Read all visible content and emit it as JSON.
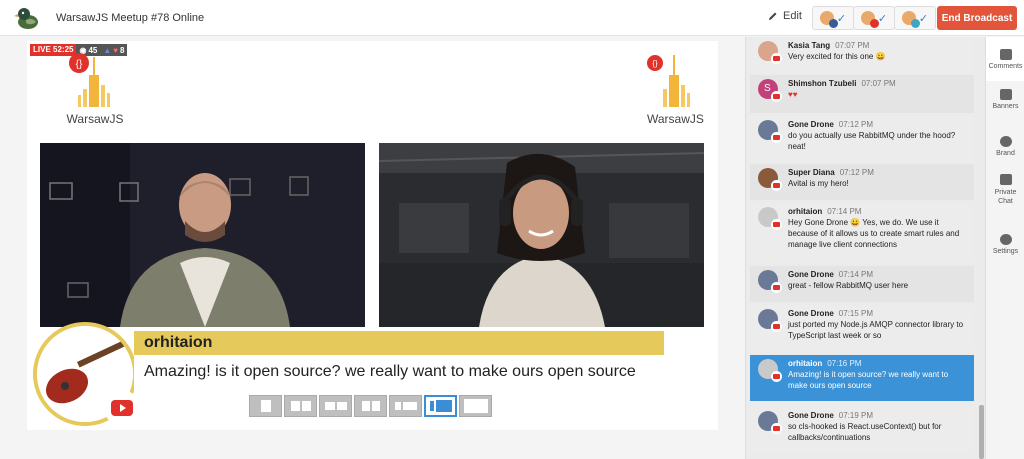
{
  "header": {
    "title": "WarsawJS Meetup #78 Online",
    "edit_label": "Edit",
    "end_label": "End Broadcast",
    "destinations": [
      {
        "network": "facebook",
        "color": "#3b5998"
      },
      {
        "network": "youtube",
        "color": "#e0322a"
      },
      {
        "network": "periscope",
        "color": "#40a4c4"
      }
    ]
  },
  "stage": {
    "live_label": "LIVE 52:25",
    "viewers": "45",
    "reactions": "8",
    "brand_text": "WarsawJS",
    "banner": {
      "name": "orhitaion",
      "message": "Amazing! is it open source? we really want to make ours open source"
    }
  },
  "chat": [
    {
      "name": "Kasia Tang",
      "time": "07:07 PM",
      "text": "Very excited for this one 😀",
      "avatar_color": "#d9a58c"
    },
    {
      "name": "Shimshon Tzubeli",
      "time": "07:07 PM",
      "text": "♥♥",
      "avatar_color": "#c2417a",
      "initial": "S"
    },
    {
      "name": "Gone Drone",
      "time": "07:12 PM",
      "text": "do you actually use RabbitMQ under the hood? neat!",
      "avatar_color": "#6a7a96"
    },
    {
      "name": "Super Diana",
      "time": "07:12 PM",
      "text": "Avital is my hero!",
      "avatar_color": "#8a5a3a"
    },
    {
      "name": "orhitaion",
      "time": "07:14 PM",
      "text": "Hey Gone Drone 😀 Yes, we do. We use it because of it allows us to create smart rules and manage live client connections",
      "avatar_color": "#c9c9c9"
    },
    {
      "name": "Gone Drone",
      "time": "07:14 PM",
      "text": "great - fellow RabbitMQ user here",
      "avatar_color": "#6a7a96"
    },
    {
      "name": "Gone Drone",
      "time": "07:15 PM",
      "text": "just ported my Node.js AMQP connector library to TypeScript last week or so",
      "avatar_color": "#6a7a96"
    },
    {
      "name": "orhitaion",
      "time": "07:16 PM",
      "text": "Amazing! is it open source? we really want to make ours open source",
      "avatar_color": "#c9c9c9"
    },
    {
      "name": "Gone Drone",
      "time": "07:19 PM",
      "text": "so cls-hooked is React.useContext() but for callbacks/continuations",
      "avatar_color": "#6a7a96"
    }
  ],
  "rail": [
    {
      "label": "Comments"
    },
    {
      "label": "Banners"
    },
    {
      "label": "Brand"
    },
    {
      "label": "Private Chat"
    },
    {
      "label": "Settings"
    }
  ],
  "colors": {
    "accent": "#3b92d6",
    "end_button": "#e2553a",
    "banner_yellow": "#e5c95a",
    "live_red": "#e0322a"
  }
}
